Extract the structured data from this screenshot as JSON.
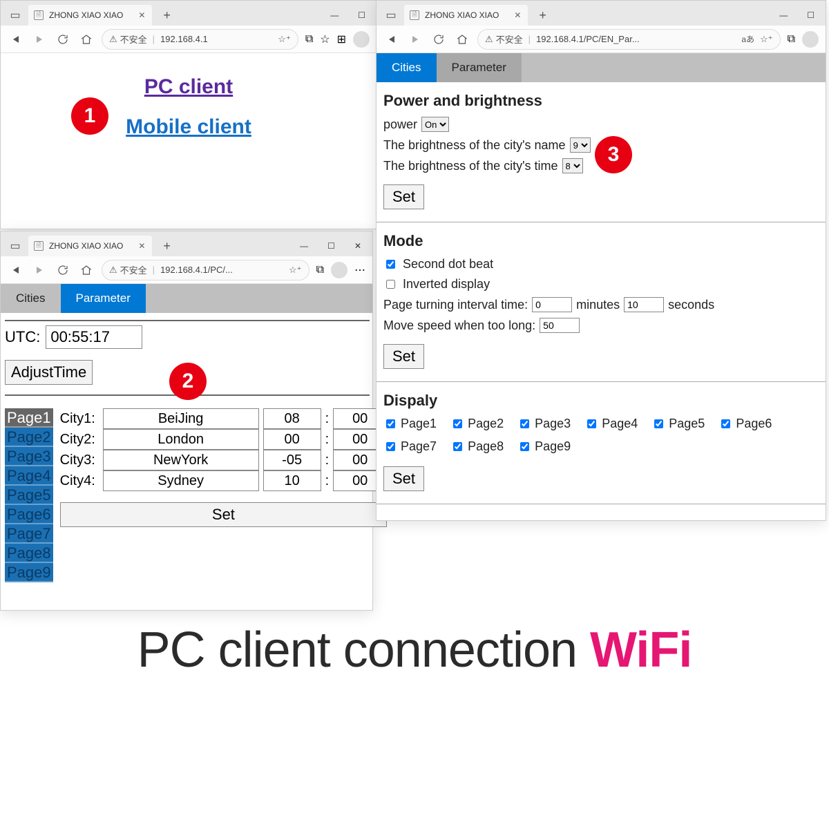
{
  "common": {
    "tab_title": "ZHONG XIAO XIAO",
    "insecure_label": "不安全"
  },
  "window1": {
    "url": "192.168.4.1",
    "links": {
      "pc": "PC client",
      "mobile": "Mobile client"
    },
    "badge": "1"
  },
  "window2": {
    "url": "192.168.4.1/PC/...",
    "tabs": {
      "cities": "Cities",
      "parameter": "Parameter",
      "active": "parameter"
    },
    "utc_label": "UTC:",
    "utc_value": "00:55:17",
    "adjust_label": "AdjustTime",
    "pages": [
      "Page1",
      "Page2",
      "Page3",
      "Page4",
      "Page5",
      "Page6",
      "Page7",
      "Page8",
      "Page9"
    ],
    "selected_page": 0,
    "city_rows": [
      {
        "label": "City1:",
        "name": "BeiJing",
        "tz": "08",
        "min": "00"
      },
      {
        "label": "City2:",
        "name": "London",
        "tz": "00",
        "min": "00"
      },
      {
        "label": "City3:",
        "name": "NewYork",
        "tz": "-05",
        "min": "00"
      },
      {
        "label": "City4:",
        "name": "Sydney",
        "tz": "10",
        "min": "00"
      }
    ],
    "set_label": "Set",
    "badge": "2"
  },
  "window3": {
    "url": "192.168.4.1/PC/EN_Par...",
    "lang_token": "aあ",
    "tabs": {
      "cities": "Cities",
      "parameter": "Parameter",
      "active": "cities"
    },
    "sections": {
      "power": {
        "title": "Power and brightness",
        "power_label": "power",
        "power_value": "On",
        "bright_name_label": "The brightness of the city's name",
        "bright_name_value": "9",
        "bright_time_label": "The brightness of the city's time",
        "bright_time_value": "8",
        "set": "Set"
      },
      "mode": {
        "title": "Mode",
        "second_dot": {
          "label": "Second dot beat",
          "checked": true
        },
        "inverted": {
          "label": "Inverted display",
          "checked": false
        },
        "interval_prefix": "Page turning interval time:",
        "interval_min": "0",
        "interval_min_label": "minutes",
        "interval_sec": "10",
        "interval_sec_label": "seconds",
        "move_prefix": "Move speed when too long:",
        "move_value": "50",
        "set": "Set"
      },
      "display": {
        "title": "Dispaly",
        "pages": [
          {
            "label": "Page1",
            "checked": true
          },
          {
            "label": "Page2",
            "checked": true
          },
          {
            "label": "Page3",
            "checked": true
          },
          {
            "label": "Page4",
            "checked": true
          },
          {
            "label": "Page5",
            "checked": true
          },
          {
            "label": "Page6",
            "checked": true
          },
          {
            "label": "Page7",
            "checked": true
          },
          {
            "label": "Page8",
            "checked": true
          },
          {
            "label": "Page9",
            "checked": true
          }
        ],
        "set": "Set"
      }
    },
    "badge": "3"
  },
  "caption": {
    "text": "PC client connection ",
    "wifi": "WiFi"
  }
}
